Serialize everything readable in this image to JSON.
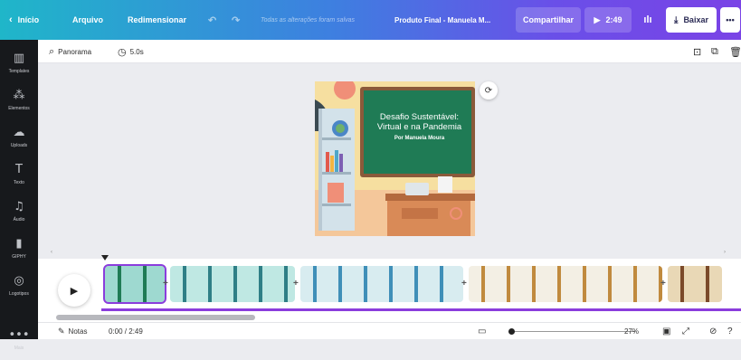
{
  "topbar": {
    "back_label": "Início",
    "file_label": "Arquivo",
    "resize_label": "Redimensionar",
    "save_status": "Todas as alterações foram salvas",
    "project_title": "Produto Final - Manuela M...",
    "share_label": "Compartilhar",
    "play_duration": "2:49",
    "download_label": "Baixar",
    "more_label": "•••",
    "colors": {
      "gradient_start": "#1fb6c9",
      "gradient_end": "#7a43e6"
    }
  },
  "sidebar": {
    "items": [
      {
        "label": "Templates",
        "icon": "templates-icon",
        "glyph": "▥"
      },
      {
        "label": "Elementos",
        "icon": "elements-icon",
        "glyph": "⁂"
      },
      {
        "label": "Uploads",
        "icon": "upload-icon",
        "glyph": "☁"
      },
      {
        "label": "Texto",
        "icon": "text-icon",
        "glyph": "T"
      },
      {
        "label": "Áudio",
        "icon": "audio-icon",
        "glyph": "♫"
      },
      {
        "label": "GIPHY",
        "icon": "giphy-icon",
        "glyph": "▮"
      },
      {
        "label": "Logotipos",
        "icon": "logos-icon",
        "glyph": "◎"
      },
      {
        "label": "Mais",
        "icon": "more-icon",
        "glyph": "•••"
      }
    ]
  },
  "toolbar": {
    "panorama_label": "Panorama",
    "duration_label": "5.0s"
  },
  "design": {
    "title_line1": "Desafio Sustentável:",
    "title_line2": "Virtual e na Pandemia",
    "author": "Por Manuela Moura"
  },
  "timeline": {
    "clips": [
      {
        "name": "clip-1",
        "theme": "board",
        "width": 66
      },
      {
        "name": "clip-2",
        "theme": "teacher",
        "width": 138
      },
      {
        "name": "clip-3",
        "theme": "doctor",
        "width": 180
      },
      {
        "name": "clip-4",
        "theme": "stage",
        "width": 214
      },
      {
        "name": "clip-5",
        "theme": "class",
        "width": 60
      }
    ]
  },
  "statusbar": {
    "notes_label": "Notas",
    "time_label": "0:00 / 2:49",
    "zoom_label": "27%",
    "zoom_value": 0.27
  }
}
